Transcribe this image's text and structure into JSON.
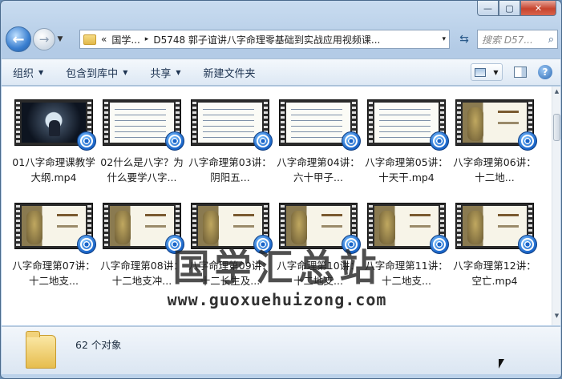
{
  "window": {
    "caption_minimize": "—",
    "caption_maximize": "▢",
    "caption_close": "✕"
  },
  "address": {
    "overflow": "«",
    "segments": [
      "国学...",
      "D5748 郭子谊讲八字命理零基础到实战应用视频课..."
    ],
    "separator": "▸",
    "dropdown": "▾"
  },
  "search": {
    "placeholder": "搜索 D57..."
  },
  "toolbar": {
    "organize": "组织",
    "include_library": "包含到库中",
    "share": "共享",
    "new_folder": "新建文件夹",
    "arrow": "▼"
  },
  "files": [
    {
      "label": "01八字命理课教学大纲.mp4",
      "thumb": "intro"
    },
    {
      "label": "02什么是八字？为什么要学八字...",
      "thumb": "doc"
    },
    {
      "label": "八字命理第03讲：阴阳五...",
      "thumb": "doc"
    },
    {
      "label": "八字命理第04讲：六十甲子...",
      "thumb": "doc"
    },
    {
      "label": "八字命理第05讲：十天干.mp4",
      "thumb": "doc"
    },
    {
      "label": "八字命理第06讲：十二地...",
      "thumb": "art"
    },
    {
      "label": "八字命理第07讲：十二地支...",
      "thumb": "art"
    },
    {
      "label": "八字命理第08讲：十二地支冲...",
      "thumb": "art"
    },
    {
      "label": "八字命理第09讲：十二长生及...",
      "thumb": "art"
    },
    {
      "label": "八字命理第10讲：十二地支...",
      "thumb": "art"
    },
    {
      "label": "八字命理第11讲：十二地支...",
      "thumb": "art"
    },
    {
      "label": "八字命理第12讲：空亡.mp4",
      "thumb": "art"
    }
  ],
  "watermark": {
    "title": "国学汇总站",
    "url": "www.guoxuehuizong.com"
  },
  "status": {
    "count_text": "62 个对象"
  }
}
